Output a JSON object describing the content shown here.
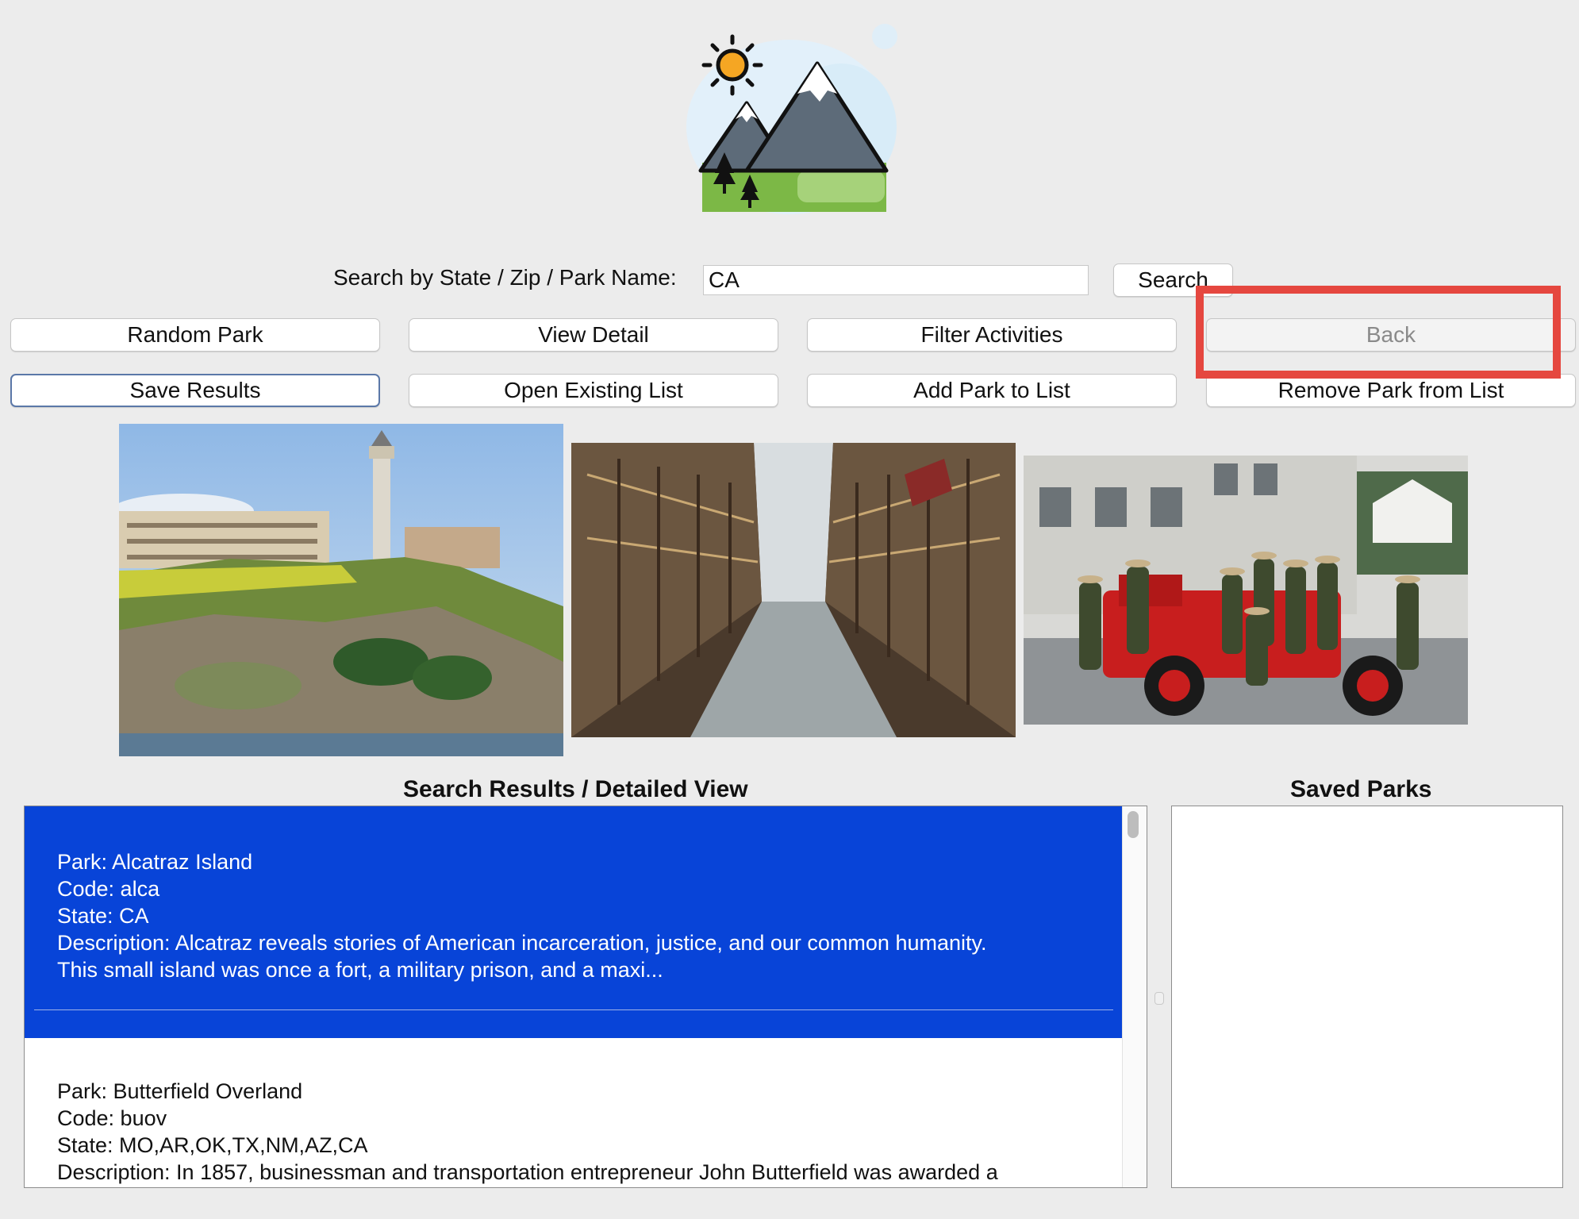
{
  "search": {
    "label": "Search by State / Zip / Park Name:",
    "value": "CA",
    "button": "Search"
  },
  "buttons": {
    "row1": [
      "Random Park",
      "View Detail",
      "Filter Activities",
      "Back"
    ],
    "row2": [
      "Save Results",
      "Open Existing List",
      "Add Park to List",
      "Remove Park from List"
    ]
  },
  "photos": [
    "alcatraz-island-photo",
    "cellhouse-corridor-photo",
    "rangers-fire-truck-photo"
  ],
  "results": {
    "heading": "Search Results / Detailed View",
    "items": [
      {
        "park": "Park: Alcatraz Island",
        "code": "Code: alca",
        "state": "State: CA",
        "description": "Description: Alcatraz reveals stories of American incarceration, justice, and our common humanity.",
        "description_2": "This small island was once a fort, a military prison, and a maxi...",
        "selected": true
      },
      {
        "park": "Park: Butterfield Overland",
        "code": "Code: buov",
        "state": "State: MO,AR,OK,TX,NM,AZ,CA",
        "description": "Description: In 1857, businessman and transportation entrepreneur John Butterfield was awarded a",
        "selected": false
      }
    ]
  },
  "saved": {
    "heading": "Saved Parks"
  },
  "colors": {
    "selection": "#0844d8",
    "highlight": "#e5473f",
    "background": "#ececec"
  }
}
